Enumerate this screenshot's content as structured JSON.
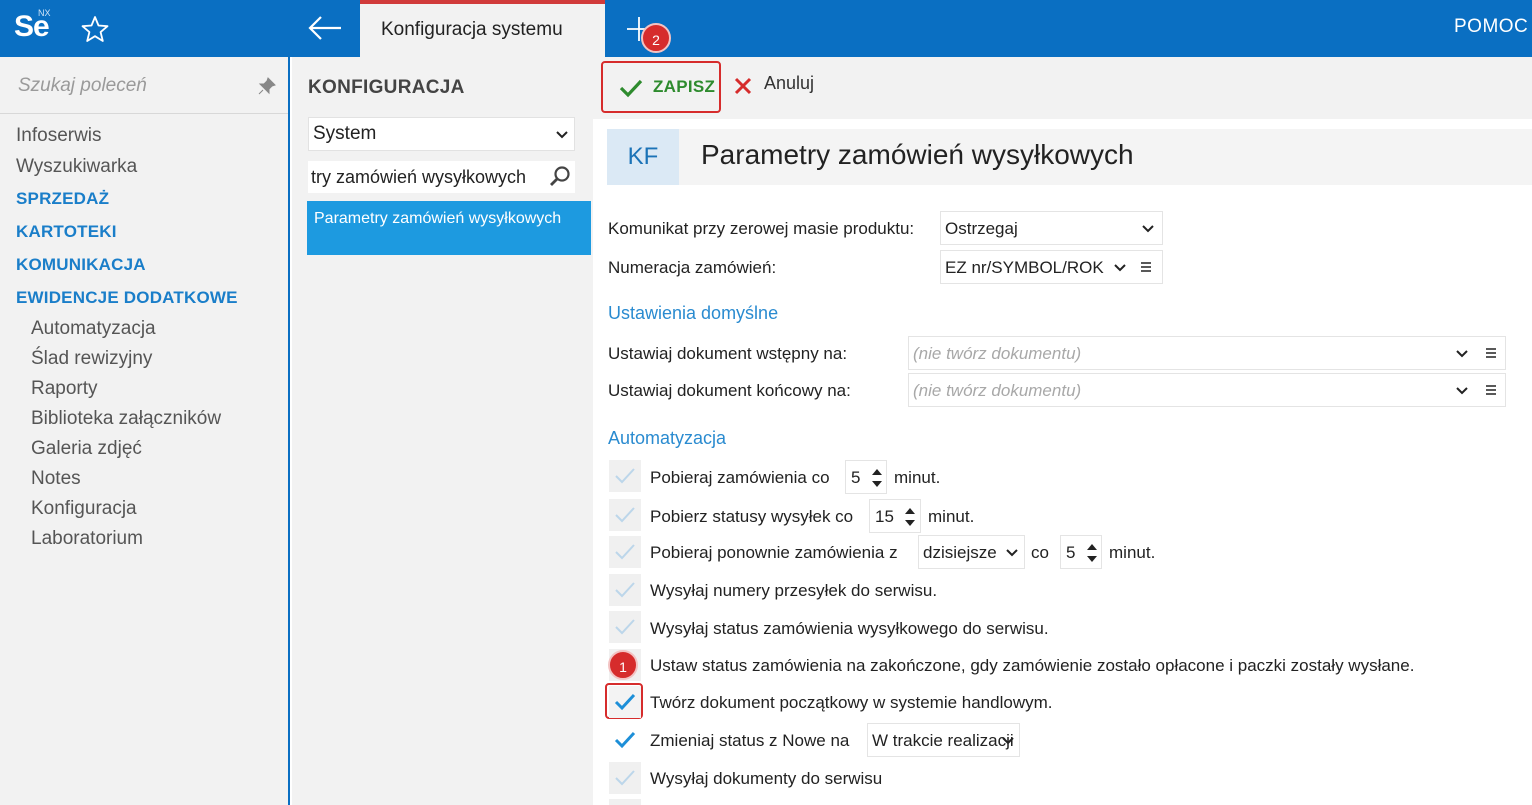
{
  "app": {
    "logo": "Se",
    "logo_badge": "NX",
    "active_tab": "Konfiguracja systemu",
    "help": "POMOC",
    "badge_add": "2",
    "badge_row": "1"
  },
  "leftnav": {
    "search_placeholder": "Szukaj poleceń",
    "items": [
      "Infoserwis",
      "Wyszukiwarka"
    ],
    "sections": [
      "SPRZEDAŻ",
      "KARTOTEKI",
      "KOMUNIKACJA",
      "EWIDENCJE DODATKOWE"
    ],
    "subitems": [
      "Automatyzacja",
      "Ślad rewizyjny",
      "Raporty",
      "Biblioteka załączników",
      "Galeria zdjęć",
      "Notes",
      "Konfiguracja",
      "Laboratorium"
    ]
  },
  "config": {
    "title": "KONFIGURACJA",
    "select": "System",
    "search": "try zamówień wysyłkowych",
    "selected_item": "Parametry zamówień wysyłkowych"
  },
  "toolbar": {
    "save": "ZAPISZ",
    "cancel": "Anuluj"
  },
  "header": {
    "code": "KF",
    "title": "Parametry zamówień wysyłkowych"
  },
  "form": {
    "zero_mass_label": "Komunikat przy zerowej masie produktu:",
    "zero_mass_value": "Ostrzegaj",
    "numbering_label": "Numeracja zamówień:",
    "numbering_value": "EZ nr/SYMBOL/ROK",
    "defaults_section": "Ustawienia domyślne",
    "initial_doc_label": "Ustawiaj dokument wstępny na:",
    "initial_doc_placeholder": "(nie twórz dokumentu)",
    "final_doc_label": "Ustawiaj dokument końcowy na:",
    "final_doc_placeholder": "(nie twórz dokumentu)",
    "automation_section": "Automatyzacja",
    "fetch_orders_label": "Pobieraj zamówienia co",
    "fetch_orders_value": "5",
    "fetch_orders_unit": "minut.",
    "fetch_status_label": "Pobierz statusy wysyłek co",
    "fetch_status_value": "15",
    "fetch_status_unit": "minut.",
    "refetch_label": "Pobieraj ponownie zamówienia z",
    "refetch_from": "dzisiejsze",
    "refetch_every": "co",
    "refetch_value": "5",
    "refetch_unit": "minut.",
    "send_numbers_label": "Wysyłaj numery przesyłek do serwisu.",
    "send_status_label": "Wysyłaj status zamówienia wysyłkowego do serwisu.",
    "set_completed_label": "Ustaw status zamówienia na zakończone, gdy zamówienie zostało opłacone i paczki zostały wysłane.",
    "create_doc_label": "Twórz dokument początkowy w systemie handlowym.",
    "change_status_label": "Zmieniaj status z Nowe na",
    "change_status_value": "W trakcie realizacji",
    "send_docs_label": "Wysyłaj dokumenty do serwisu"
  },
  "colors": {
    "topbar": "#0a6fc2",
    "accent": "#1d9ae0",
    "section": "#2a8bd0",
    "save_green": "#2e8b2e",
    "highlight_red": "#d62c2c"
  }
}
